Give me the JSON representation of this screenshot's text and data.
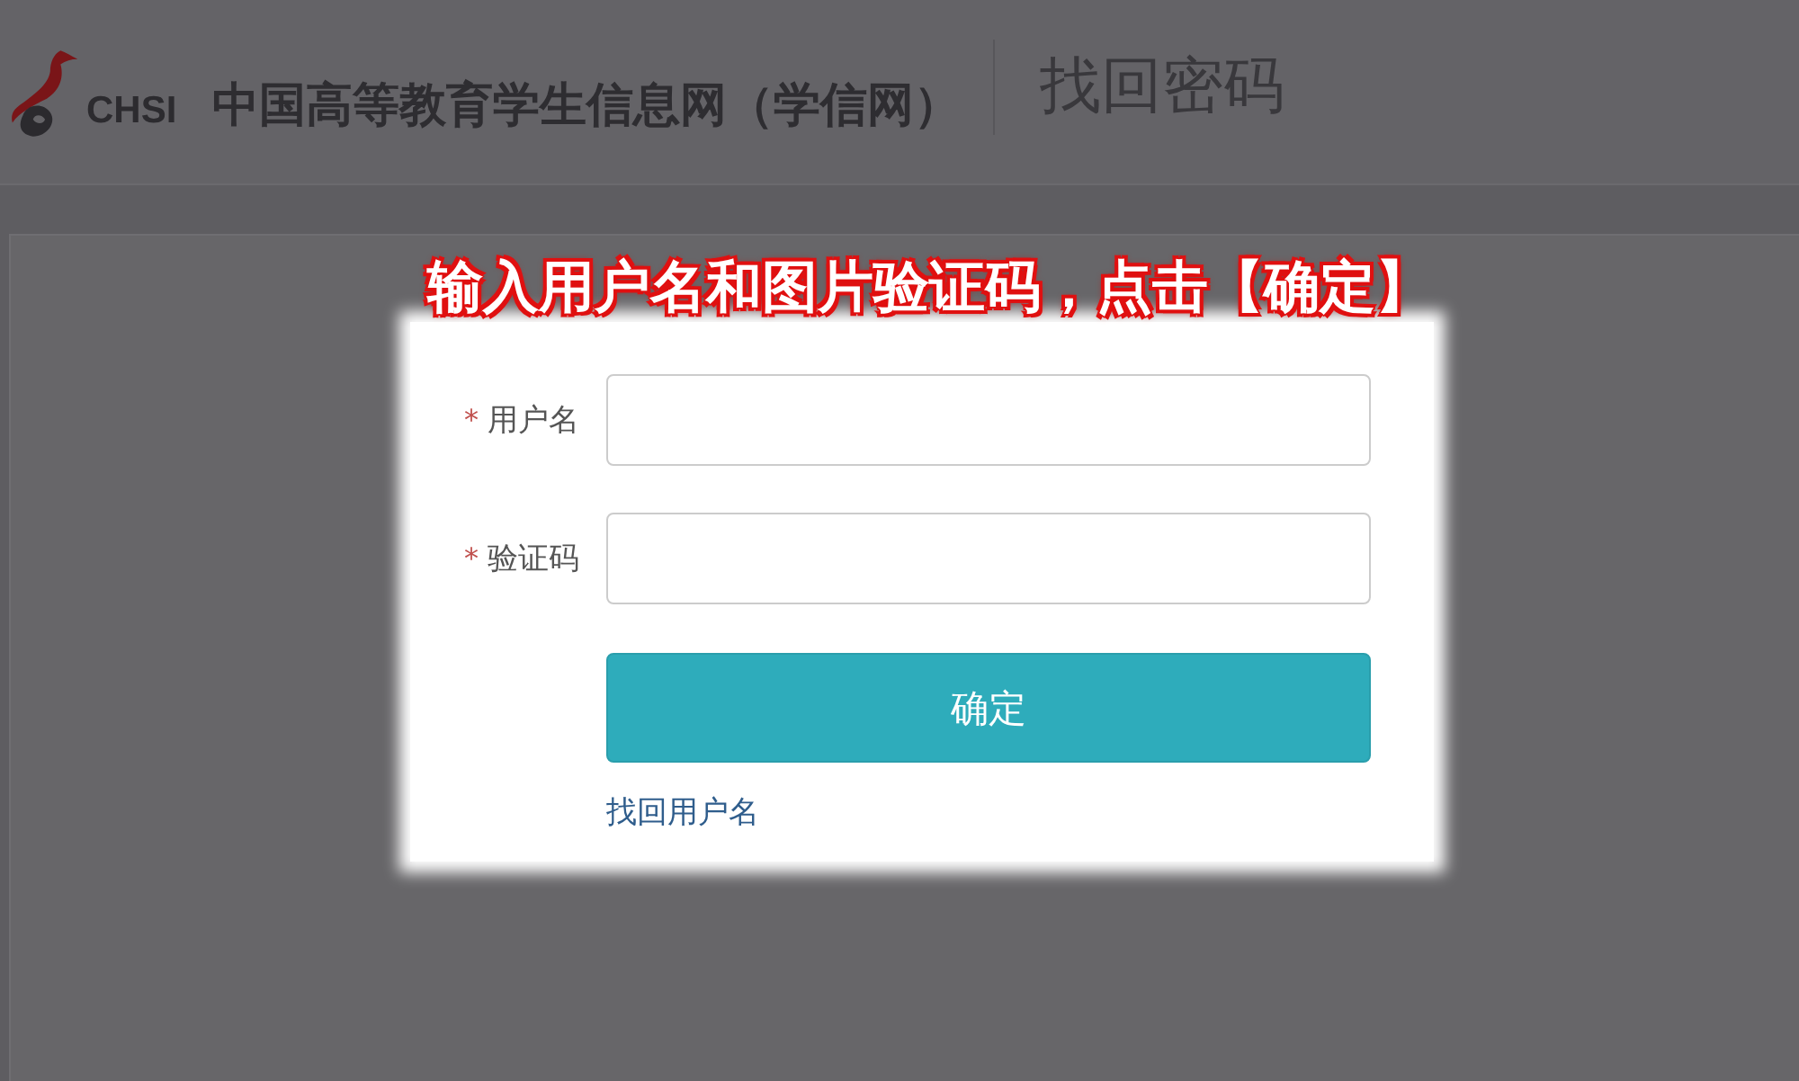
{
  "header": {
    "logo_text": "CHSI",
    "site_name": "中国高等教育学生信息网（学信网）",
    "page_title": "找回密码"
  },
  "annotation": "输入用户名和图片验证码，点击【确定】",
  "form": {
    "fields": [
      {
        "required_mark": "*",
        "label": "用户名"
      },
      {
        "required_mark": "*",
        "label": "验证码"
      }
    ],
    "submit": "确定",
    "link": "找回用户名"
  }
}
